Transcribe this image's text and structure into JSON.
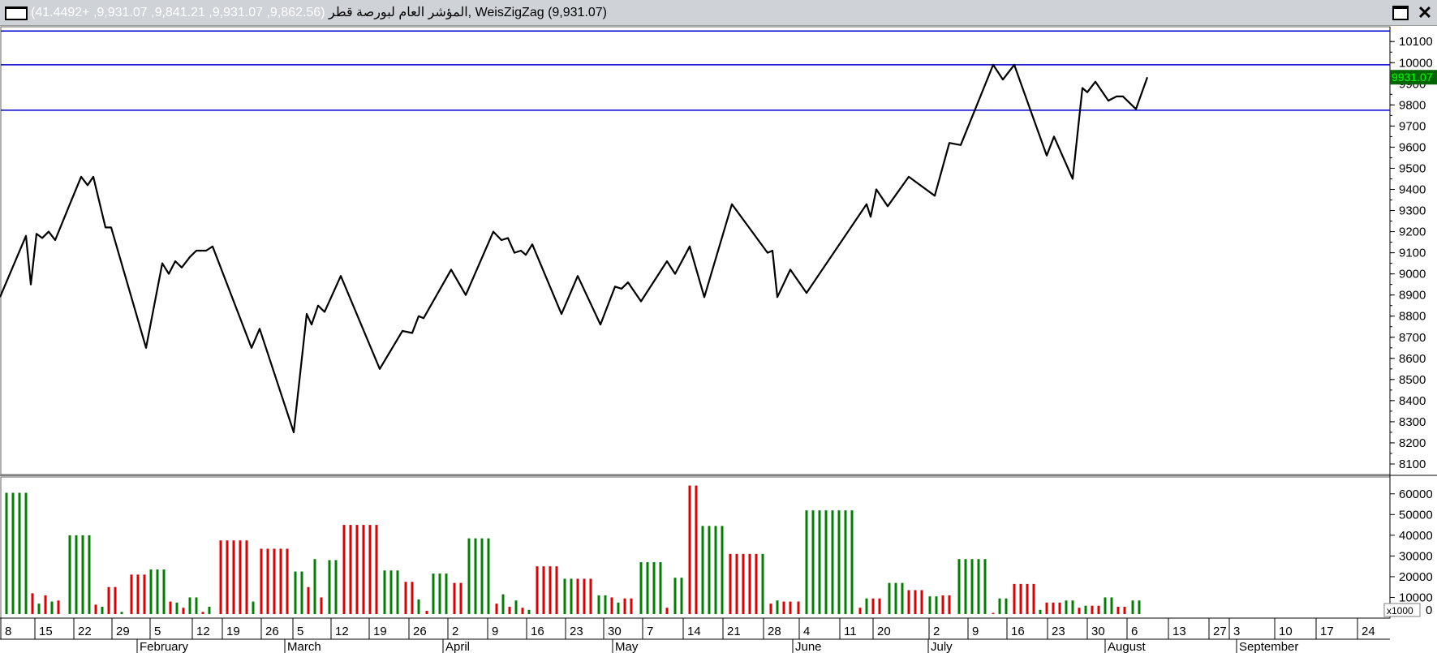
{
  "window": {
    "title_name": "المؤشر العام لبورصة قطر",
    "title_values": "(9,862.56, 9,931.07, 9,841.21, 9,931.07, +41.4492)",
    "title_indicator": ", WeisZigZag (9,931.07)",
    "close_label": "✕"
  },
  "price_axis": {
    "ticks": [
      10100,
      10000,
      9900,
      9800,
      9700,
      9600,
      9500,
      9400,
      9300,
      9200,
      9100,
      9000,
      8900,
      8800,
      8700,
      8600,
      8500,
      8400,
      8300,
      8200,
      8100
    ],
    "last_value_label": "9931.07",
    "last_value_bg": "#006400",
    "last_value_fg": "#00ff00"
  },
  "volume_axis": {
    "ticks": [
      60000,
      50000,
      40000,
      30000,
      20000,
      10000
    ],
    "multiplier_label": "x1000",
    "zero_label": "0"
  },
  "x_axis": {
    "day_labels": [
      "8",
      "15",
      "22",
      "29",
      "5",
      "12",
      "19",
      "26",
      "5",
      "12",
      "19",
      "26",
      "2",
      "9",
      "16",
      "23",
      "30",
      "7",
      "14",
      "21",
      "28",
      "4",
      "11",
      "20",
      "2",
      "9",
      "16",
      "23",
      "30",
      "6",
      "13",
      "27",
      "3",
      "10",
      "17",
      "24"
    ],
    "month_labels": [
      "February",
      "March",
      "April",
      "May",
      "June",
      "July",
      "August",
      "September"
    ]
  },
  "colors": {
    "line": "#000000",
    "level_line": "#0000cc",
    "volume_up": "#008000",
    "volume_down": "#e00000"
  },
  "chart_data": {
    "type": "line",
    "price": {
      "name": "WeisZigZag",
      "ylim": [
        8050,
        10170
      ],
      "levels": [
        10150,
        9990,
        9775
      ],
      "points": [
        [
          0,
          8890
        ],
        [
          32,
          9180
        ],
        [
          38,
          8950
        ],
        [
          45,
          9190
        ],
        [
          52,
          9170
        ],
        [
          60,
          9200
        ],
        [
          68,
          9160
        ],
        [
          85,
          9320
        ],
        [
          100,
          9460
        ],
        [
          108,
          9420
        ],
        [
          115,
          9460
        ],
        [
          130,
          9220
        ],
        [
          137,
          9220
        ],
        [
          180,
          8650
        ],
        [
          200,
          9050
        ],
        [
          208,
          9000
        ],
        [
          216,
          9060
        ],
        [
          224,
          9030
        ],
        [
          234,
          9080
        ],
        [
          242,
          9110
        ],
        [
          254,
          9110
        ],
        [
          262,
          9130
        ],
        [
          310,
          8650
        ],
        [
          320,
          8740
        ],
        [
          362,
          8250
        ],
        [
          378,
          8810
        ],
        [
          384,
          8760
        ],
        [
          392,
          8850
        ],
        [
          400,
          8820
        ],
        [
          420,
          8990
        ],
        [
          468,
          8550
        ],
        [
          496,
          8730
        ],
        [
          508,
          8720
        ],
        [
          516,
          8800
        ],
        [
          522,
          8790
        ],
        [
          556,
          9020
        ],
        [
          574,
          8900
        ],
        [
          608,
          9200
        ],
        [
          618,
          9160
        ],
        [
          626,
          9170
        ],
        [
          634,
          9100
        ],
        [
          642,
          9110
        ],
        [
          648,
          9090
        ],
        [
          656,
          9140
        ],
        [
          692,
          8810
        ],
        [
          712,
          8990
        ],
        [
          740,
          8760
        ],
        [
          758,
          8940
        ],
        [
          766,
          8930
        ],
        [
          774,
          8960
        ],
        [
          790,
          8870
        ],
        [
          822,
          9060
        ],
        [
          832,
          9000
        ],
        [
          850,
          9130
        ],
        [
          868,
          8890
        ],
        [
          902,
          9330
        ],
        [
          946,
          9100
        ],
        [
          952,
          9110
        ],
        [
          958,
          8890
        ],
        [
          974,
          9020
        ],
        [
          994,
          8910
        ],
        [
          1068,
          9330
        ],
        [
          1073,
          9270
        ],
        [
          1080,
          9400
        ],
        [
          1094,
          9320
        ],
        [
          1120,
          9460
        ],
        [
          1152,
          9370
        ],
        [
          1170,
          9620
        ],
        [
          1184,
          9610
        ],
        [
          1224,
          9990
        ],
        [
          1236,
          9920
        ],
        [
          1250,
          9990
        ],
        [
          1290,
          9560
        ],
        [
          1299,
          9650
        ],
        [
          1322,
          9450
        ],
        [
          1334,
          9880
        ],
        [
          1340,
          9860
        ],
        [
          1350,
          9910
        ],
        [
          1366,
          9820
        ],
        [
          1376,
          9840
        ],
        [
          1384,
          9840
        ],
        [
          1400,
          9780
        ],
        [
          1414,
          9931
        ]
      ]
    },
    "volume": {
      "unit": "x1000",
      "ylim": [
        0,
        65000
      ],
      "bars": [
        [
          8,
          60500,
          "up"
        ],
        [
          16,
          60500,
          "up"
        ],
        [
          24,
          60500,
          "up"
        ],
        [
          32,
          60500,
          "up"
        ],
        [
          40,
          12000,
          "down"
        ],
        [
          48,
          7000,
          "up"
        ],
        [
          56,
          11000,
          "down"
        ],
        [
          64,
          8000,
          "up"
        ],
        [
          72,
          8500,
          "down"
        ],
        [
          86,
          40000,
          "up"
        ],
        [
          94,
          40000,
          "up"
        ],
        [
          102,
          40000,
          "up"
        ],
        [
          110,
          40000,
          "up"
        ],
        [
          118,
          6500,
          "down"
        ],
        [
          126,
          5500,
          "up"
        ],
        [
          134,
          15000,
          "down"
        ],
        [
          142,
          15000,
          "down"
        ],
        [
          150,
          3000,
          "up"
        ],
        [
          162,
          21000,
          "down"
        ],
        [
          170,
          21000,
          "down"
        ],
        [
          178,
          21000,
          "down"
        ],
        [
          186,
          23500,
          "up"
        ],
        [
          194,
          23500,
          "up"
        ],
        [
          202,
          23500,
          "up"
        ],
        [
          210,
          8000,
          "down"
        ],
        [
          218,
          7500,
          "up"
        ],
        [
          226,
          5000,
          "down"
        ],
        [
          234,
          10000,
          "up"
        ],
        [
          242,
          10000,
          "up"
        ],
        [
          250,
          3000,
          "down"
        ],
        [
          258,
          5500,
          "up"
        ],
        [
          272,
          37500,
          "down"
        ],
        [
          280,
          37500,
          "down"
        ],
        [
          288,
          37500,
          "down"
        ],
        [
          296,
          37500,
          "down"
        ],
        [
          304,
          37500,
          "down"
        ],
        [
          312,
          8000,
          "up"
        ],
        [
          322,
          33500,
          "down"
        ],
        [
          330,
          33500,
          "down"
        ],
        [
          338,
          33500,
          "down"
        ],
        [
          346,
          33500,
          "down"
        ],
        [
          354,
          33500,
          "down"
        ],
        [
          364,
          22500,
          "up"
        ],
        [
          372,
          22500,
          "up"
        ],
        [
          380,
          15000,
          "down"
        ],
        [
          388,
          28500,
          "up"
        ],
        [
          396,
          10000,
          "down"
        ],
        [
          406,
          28000,
          "up"
        ],
        [
          414,
          28000,
          "up"
        ],
        [
          424,
          45000,
          "down"
        ],
        [
          432,
          45000,
          "down"
        ],
        [
          440,
          45000,
          "down"
        ],
        [
          448,
          45000,
          "down"
        ],
        [
          456,
          45000,
          "down"
        ],
        [
          464,
          45000,
          "down"
        ],
        [
          474,
          23000,
          "up"
        ],
        [
          482,
          23000,
          "up"
        ],
        [
          490,
          23000,
          "up"
        ],
        [
          500,
          17500,
          "down"
        ],
        [
          508,
          17500,
          "down"
        ],
        [
          516,
          9000,
          "up"
        ],
        [
          526,
          3500,
          "down"
        ],
        [
          534,
          21500,
          "up"
        ],
        [
          542,
          21500,
          "up"
        ],
        [
          550,
          21500,
          "up"
        ],
        [
          560,
          17000,
          "down"
        ],
        [
          568,
          17000,
          "down"
        ],
        [
          578,
          38500,
          "up"
        ],
        [
          586,
          38500,
          "up"
        ],
        [
          594,
          38500,
          "up"
        ],
        [
          602,
          38500,
          "up"
        ],
        [
          612,
          7000,
          "down"
        ],
        [
          620,
          11500,
          "up"
        ],
        [
          628,
          5500,
          "down"
        ],
        [
          636,
          8500,
          "up"
        ],
        [
          644,
          5000,
          "down"
        ],
        [
          652,
          4000,
          "up"
        ],
        [
          662,
          25000,
          "down"
        ],
        [
          670,
          25000,
          "down"
        ],
        [
          678,
          25000,
          "down"
        ],
        [
          686,
          25000,
          "down"
        ],
        [
          696,
          19000,
          "up"
        ],
        [
          704,
          19000,
          "up"
        ],
        [
          712,
          19000,
          "down"
        ],
        [
          720,
          19000,
          "down"
        ],
        [
          728,
          19000,
          "down"
        ],
        [
          738,
          11000,
          "up"
        ],
        [
          746,
          11000,
          "up"
        ],
        [
          754,
          10000,
          "down"
        ],
        [
          762,
          7500,
          "up"
        ],
        [
          770,
          9500,
          "down"
        ],
        [
          778,
          9500,
          "down"
        ],
        [
          790,
          27000,
          "up"
        ],
        [
          798,
          27000,
          "up"
        ],
        [
          806,
          27000,
          "up"
        ],
        [
          814,
          27000,
          "up"
        ],
        [
          822,
          5000,
          "down"
        ],
        [
          832,
          19500,
          "up"
        ],
        [
          840,
          19500,
          "up"
        ],
        [
          850,
          64000,
          "down"
        ],
        [
          858,
          64000,
          "down"
        ],
        [
          866,
          44500,
          "up"
        ],
        [
          874,
          44500,
          "up"
        ],
        [
          882,
          44500,
          "up"
        ],
        [
          890,
          44500,
          "up"
        ],
        [
          900,
          31000,
          "down"
        ],
        [
          908,
          31000,
          "down"
        ],
        [
          916,
          31000,
          "down"
        ],
        [
          924,
          31000,
          "down"
        ],
        [
          932,
          31000,
          "down"
        ],
        [
          940,
          31000,
          "up"
        ],
        [
          950,
          7000,
          "down"
        ],
        [
          958,
          8500,
          "up"
        ],
        [
          966,
          8000,
          "down"
        ],
        [
          974,
          8000,
          "down"
        ],
        [
          984,
          8000,
          "down"
        ],
        [
          994,
          52000,
          "up"
        ],
        [
          1002,
          52000,
          "up"
        ],
        [
          1010,
          52000,
          "up"
        ],
        [
          1018,
          52000,
          "up"
        ],
        [
          1026,
          52000,
          "up"
        ],
        [
          1034,
          52000,
          "up"
        ],
        [
          1042,
          52000,
          "up"
        ],
        [
          1050,
          52000,
          "up"
        ],
        [
          1060,
          5000,
          "down"
        ],
        [
          1068,
          9500,
          "up"
        ],
        [
          1076,
          9500,
          "down"
        ],
        [
          1084,
          9500,
          "down"
        ],
        [
          1096,
          17000,
          "up"
        ],
        [
          1104,
          17000,
          "up"
        ],
        [
          1112,
          17000,
          "up"
        ],
        [
          1120,
          13500,
          "down"
        ],
        [
          1128,
          13500,
          "down"
        ],
        [
          1136,
          13500,
          "down"
        ],
        [
          1146,
          10500,
          "up"
        ],
        [
          1154,
          10500,
          "up"
        ],
        [
          1162,
          11000,
          "down"
        ],
        [
          1170,
          11000,
          "down"
        ],
        [
          1182,
          28500,
          "up"
        ],
        [
          1190,
          28500,
          "up"
        ],
        [
          1198,
          28500,
          "up"
        ],
        [
          1206,
          28500,
          "up"
        ],
        [
          1214,
          28500,
          "up"
        ],
        [
          1224,
          2500,
          "down"
        ],
        [
          1232,
          9500,
          "up"
        ],
        [
          1240,
          9500,
          "up"
        ],
        [
          1250,
          16500,
          "down"
        ],
        [
          1258,
          16500,
          "down"
        ],
        [
          1266,
          16500,
          "down"
        ],
        [
          1274,
          16500,
          "down"
        ],
        [
          1282,
          4000,
          "up"
        ],
        [
          1290,
          7500,
          "down"
        ],
        [
          1298,
          7500,
          "down"
        ],
        [
          1306,
          7500,
          "down"
        ],
        [
          1314,
          8500,
          "up"
        ],
        [
          1322,
          8500,
          "up"
        ],
        [
          1330,
          5000,
          "down"
        ],
        [
          1338,
          6000,
          "up"
        ],
        [
          1346,
          6000,
          "down"
        ],
        [
          1354,
          6000,
          "down"
        ],
        [
          1362,
          10000,
          "up"
        ],
        [
          1370,
          10000,
          "up"
        ],
        [
          1378,
          5500,
          "down"
        ],
        [
          1386,
          5500,
          "down"
        ],
        [
          1396,
          8500,
          "up"
        ],
        [
          1404,
          8500,
          "up"
        ]
      ]
    }
  }
}
